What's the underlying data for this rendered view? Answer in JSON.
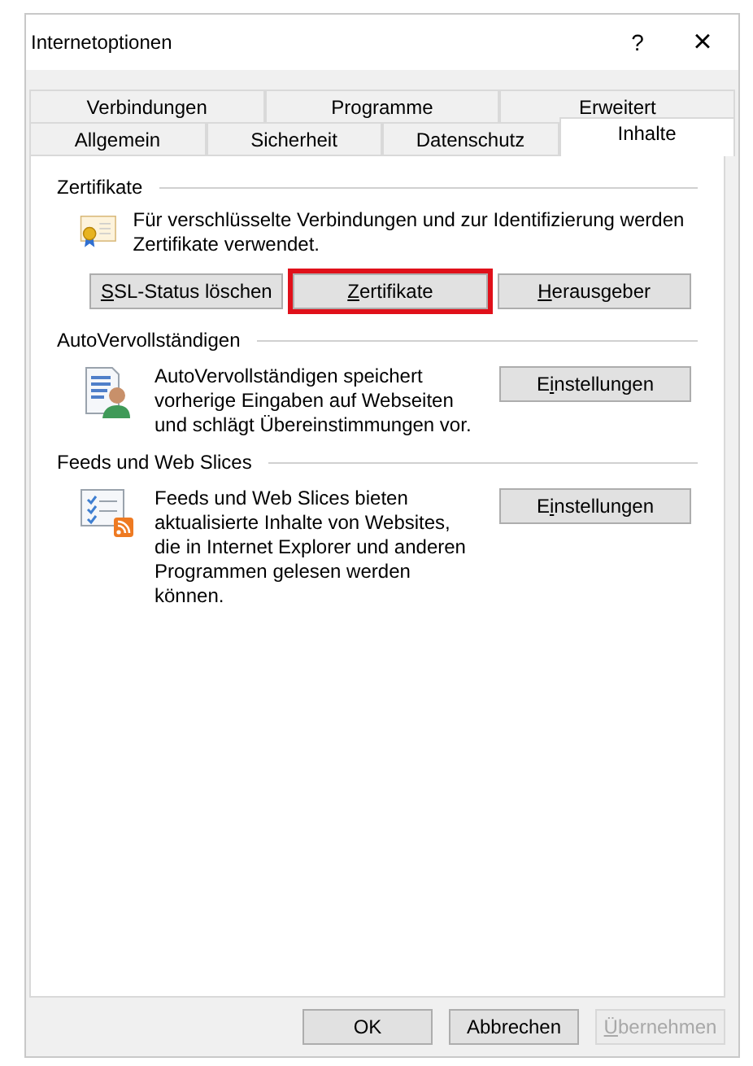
{
  "window": {
    "title": "Internetoptionen",
    "help": "?",
    "close": "×"
  },
  "tab_rows": [
    [
      {
        "label": "Verbindungen",
        "selected": false
      },
      {
        "label": "Programme",
        "selected": false
      },
      {
        "label": "Erweitert",
        "selected": false
      }
    ],
    [
      {
        "label": "Allgemein",
        "selected": false
      },
      {
        "label": "Sicherheit",
        "selected": false
      },
      {
        "label": "Datenschutz",
        "selected": false
      },
      {
        "label": "Inhalte",
        "selected": true
      }
    ]
  ],
  "groups": [
    {
      "kind": "certificate",
      "title": "Zertifikate",
      "text": "Für verschlüsselte Verbindungen und zur Identifizierung werden Zertifikate verwendet.",
      "buttons": [
        {
          "access_key": "S",
          "label_rest": "SL-Status löschen",
          "highlighted": false
        },
        {
          "access_key": "Z",
          "label_rest": "ertifikate",
          "highlighted": true
        },
        {
          "access_key": "H",
          "label_rest": "erausgeber",
          "highlighted": false
        }
      ]
    },
    {
      "kind": "autocomplete",
      "title": "AutoVervollständigen",
      "text": "AutoVervollständigen speichert vorherige Eingaben auf Webseiten und schlägt Übereinstimmungen vor.",
      "buttons": [
        {
          "label_start": "E",
          "access_key": "i",
          "label_rest": "nstellungen",
          "highlighted": false
        }
      ]
    },
    {
      "kind": "feeds",
      "title": "Feeds und Web Slices",
      "text": "Feeds und Web Slices bieten aktualisierte Inhalte von Websites, die in Internet Explorer und anderen Programmen gelesen werden können.",
      "buttons": [
        {
          "label_start": "E",
          "access_key": "i",
          "label_rest": "nstellungen",
          "highlighted": false
        }
      ]
    }
  ],
  "footer": [
    {
      "label_rest": "OK",
      "disabled": false
    },
    {
      "label_rest": "Abbrechen",
      "disabled": false
    },
    {
      "access_key": "Ü",
      "label_rest": "bernehmen",
      "disabled": true
    }
  ]
}
